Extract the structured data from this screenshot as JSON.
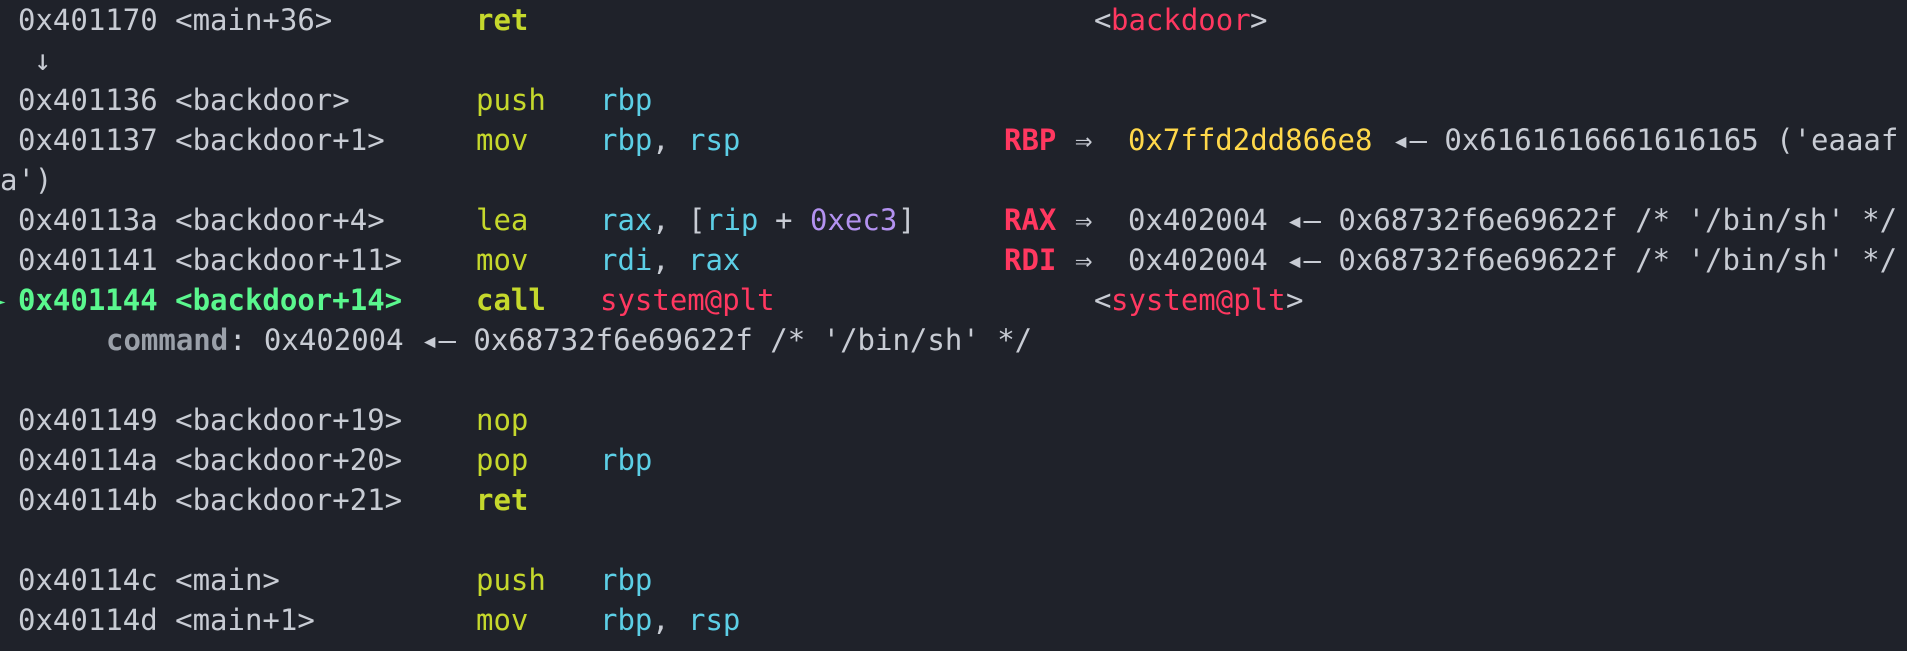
{
  "lines": {
    "l1": {
      "addr": "0x401170 <main+36>",
      "mnem": "ret",
      "tgt_open": "<",
      "tgt_sym": "backdoor",
      "tgt_close": ">"
    },
    "l2": {
      "arrow": "↓"
    },
    "l3": {
      "addr": "0x401136 <backdoor>",
      "mnem": "push",
      "op1": "rbp"
    },
    "l4": {
      "addr": "0x401137 <backdoor+1>",
      "mnem": "mov",
      "op1": "rbp",
      "comma": ",",
      "op2": "rsp",
      "reg": "RBP",
      "arrow": "⇒",
      "val": "0x7ffd2dd866e8",
      "deref": "◂— 0x6161616661616165 ('eaaaf"
    },
    "l5": {
      "wrap": "a')"
    },
    "l6": {
      "addr": "0x40113a <backdoor+4>",
      "mnem": "lea",
      "op1": "rax",
      "comma": ",",
      "br_open": "[",
      "op2": "rip",
      "plus": "+",
      "imm": "0xec3",
      "br_close": "]",
      "reg": "RAX",
      "arrow": "⇒",
      "val": "0x402004",
      "deref": "◂— 0x68732f6e69622f /* '/bin/sh' */"
    },
    "l7": {
      "addr": "0x401141 <backdoor+11>",
      "mnem": "mov",
      "op1": "rdi",
      "comma": ",",
      "op2": "rax",
      "reg": "RDI",
      "arrow": "⇒",
      "val": "0x402004",
      "deref": "◂— 0x68732f6e69622f /* '/bin/sh' */"
    },
    "l8": {
      "marker": "►",
      "addr": "0x401144 <backdoor+14>",
      "mnem": "call",
      "op1": "system@plt",
      "tgt_open": "<",
      "tgt_sym": "system@plt",
      "tgt_close": ">"
    },
    "l9": {
      "label": "command",
      "rest": ": 0x402004 ◂— 0x68732f6e69622f /* '/bin/sh' */"
    },
    "l10": {
      "addr": "0x401149 <backdoor+19>",
      "mnem": "nop"
    },
    "l11": {
      "addr": "0x40114a <backdoor+20>",
      "mnem": "pop",
      "op1": "rbp"
    },
    "l12": {
      "addr": "0x40114b <backdoor+21>",
      "mnem": "ret"
    },
    "l13": {
      "addr": "0x40114c <main>",
      "mnem": "push",
      "op1": "rbp"
    },
    "l14": {
      "addr": "0x40114d <main+1>",
      "mnem": "mov",
      "op1": "rbp",
      "comma": ",",
      "op2": "rsp"
    }
  }
}
